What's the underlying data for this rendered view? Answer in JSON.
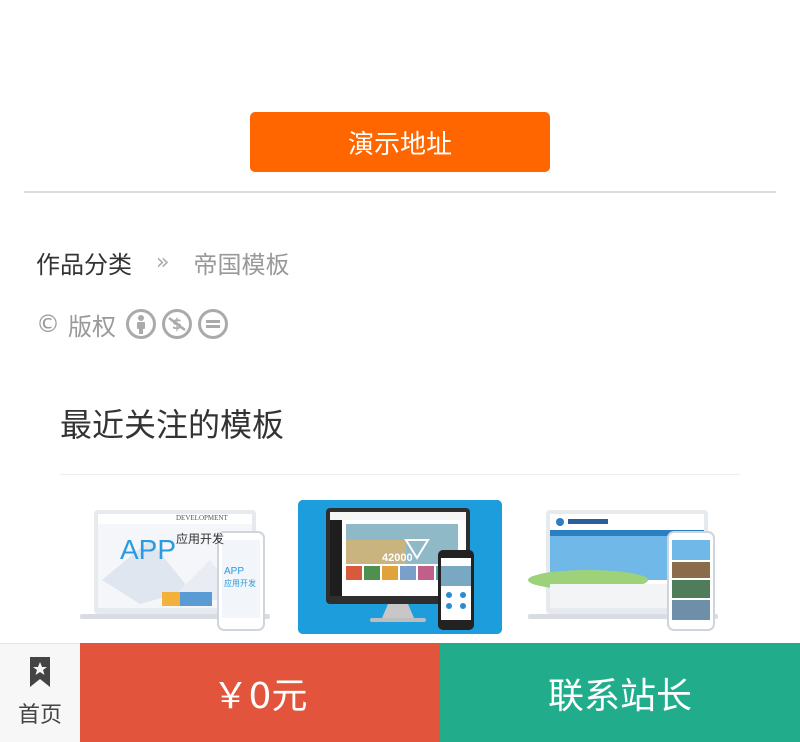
{
  "demo_button": {
    "label": "演示地址"
  },
  "breadcrumb": {
    "category": "作品分类",
    "separator": "»",
    "current": "帝国模板"
  },
  "copyright": {
    "symbol": "©",
    "label": "版权"
  },
  "recent": {
    "title": "最近关注的模板",
    "thumb1": {
      "big_text": "APP",
      "sub_text": "应用开发",
      "dev_text": "DEVELOPMENT",
      "phone_text": "APP",
      "phone_sub": "应用开发"
    },
    "thumb2": {
      "banner_text": "42000"
    }
  },
  "bottom_bar": {
    "home_label": "首页",
    "price_label": "￥0元",
    "contact_label": "联系站长"
  },
  "colors": {
    "demo_button_bg": "#ff6600",
    "price_bg": "#e2553c",
    "contact_bg": "#21ad8c",
    "thumb2_bg": "#1d9ddb"
  }
}
